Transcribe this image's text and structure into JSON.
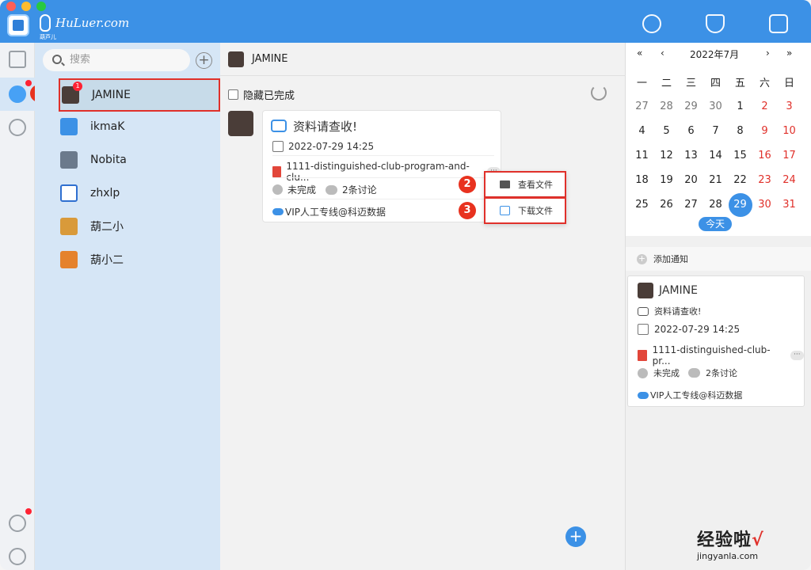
{
  "brand": {
    "text": "HuLuer.com",
    "sub": "葫芦儿"
  },
  "colors": {
    "topbar": "#3c91e6",
    "accent": "#3c91e6",
    "annotation": "#e0302a"
  },
  "top_icons": [
    "search-tag-icon",
    "star-shield-icon",
    "calendar-bell-icon"
  ],
  "sidebar": {
    "search_placeholder": "搜索"
  },
  "contacts": [
    {
      "name": "JAMINE",
      "badge": "1"
    },
    {
      "name": "ikmaK"
    },
    {
      "name": "Nobita"
    },
    {
      "name": "zhxlp"
    },
    {
      "name": "葫二小"
    },
    {
      "name": "葫小二"
    }
  ],
  "annotations": [
    "1",
    "2",
    "3"
  ],
  "chat": {
    "title": "JAMINE",
    "hide_completed": "隐藏已完成",
    "message": {
      "title": "资料请查收!",
      "datetime": "2022-07-29 14:25",
      "file": "1111-distinguished-club-program-and-clu...",
      "status": "未完成",
      "discussion": "2条讨论",
      "channel": "VIP人工专线@科迈数据",
      "more": "···"
    },
    "menu": {
      "view": "查看文件",
      "download": "下载文件"
    },
    "fab": "+"
  },
  "calendar": {
    "prev_year": "«",
    "prev_month": "‹",
    "month_title": "2022年7月",
    "next_month": "›",
    "next_year": "»",
    "weekdays": [
      "一",
      "二",
      "三",
      "四",
      "五",
      "六",
      "日"
    ],
    "weeks": [
      [
        "27",
        "28",
        "29",
        "30",
        "1",
        "2",
        "3"
      ],
      [
        "4",
        "5",
        "6",
        "7",
        "8",
        "9",
        "10"
      ],
      [
        "11",
        "12",
        "13",
        "14",
        "15",
        "16",
        "17"
      ],
      [
        "18",
        "19",
        "20",
        "21",
        "22",
        "23",
        "24"
      ],
      [
        "25",
        "26",
        "27",
        "28",
        "29",
        "30",
        "31"
      ]
    ],
    "today_label": "今天",
    "selected_day": "29"
  },
  "notice": {
    "add_label": "添加通知",
    "sender": "JAMINE",
    "title": "资料请查收!",
    "datetime": "2022-07-29 14:25",
    "file": "1111-distinguished-club-pr...",
    "more": "···",
    "status": "未完成",
    "discussion": "2条讨论",
    "channel": "VIP人工专线@科迈数据"
  },
  "watermark": {
    "text": "经验啦",
    "check": "√",
    "url": "jingyanla.com"
  }
}
